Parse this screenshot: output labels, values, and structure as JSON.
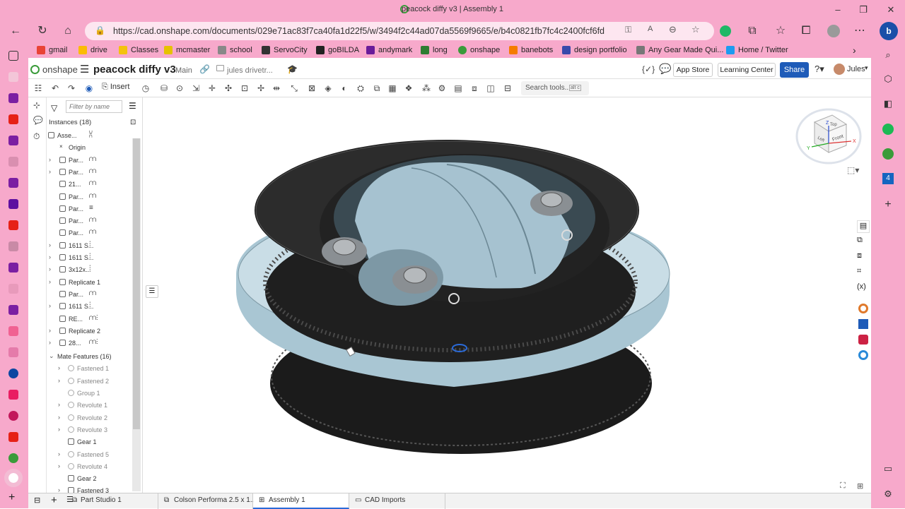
{
  "window": {
    "title": "peacock diffy v3 | Assembly 1"
  },
  "browser": {
    "url": "https://cad.onshape.com/documents/029e71ac83f7ca40fa1d22f5/w/3494f2c44ad07da5569f9665/e/b4c0821fb7fc4c2400fcf6fd"
  },
  "bookmarks": [
    "gmail",
    "drive",
    "Classes",
    "mcmaster",
    "school",
    "ServoCity",
    "goBILDA",
    "andymark",
    "long",
    "onshape",
    "banebots",
    "design portfolio",
    "Any Gear Made Qui...",
    "Home / Twitter"
  ],
  "colors": {
    "pink": "#f7a9cb",
    "share": "#1e5bb8",
    "accent": "#2a6ad8"
  },
  "onshape": {
    "brand": "onshape",
    "doc_title": "peacock diffy v3",
    "branch": "Main",
    "folder": "jules drivetr...",
    "app_store": "App Store",
    "learning_center": "Learning Center",
    "share": "Share",
    "user": "Jules"
  },
  "toolbar": {
    "insert": "Insert",
    "search": "Search tools...",
    "shortcut": "alt c"
  },
  "tree": {
    "filter_placeholder": "Filter by name",
    "instances_header": "Instances (18)",
    "rows": [
      {
        "label": "Asse...",
        "indent": 0,
        "chev": false
      },
      {
        "label": "Origin",
        "indent": 1,
        "chev": false
      },
      {
        "label": "Par...",
        "indent": 1,
        "chev": true
      },
      {
        "label": "Par...",
        "indent": 1,
        "chev": true
      },
      {
        "label": "21...",
        "indent": 1,
        "chev": false
      },
      {
        "label": "Par...",
        "indent": 1,
        "chev": false
      },
      {
        "label": "Par...",
        "indent": 1,
        "chev": false
      },
      {
        "label": "Par...",
        "indent": 1,
        "chev": false
      },
      {
        "label": "Par...",
        "indent": 1,
        "chev": false
      },
      {
        "label": "1611 S...",
        "indent": 1,
        "chev": true
      },
      {
        "label": "1611 S...",
        "indent": 1,
        "chev": true
      },
      {
        "label": "3x12x...",
        "indent": 1,
        "chev": true
      },
      {
        "label": "Replicate 1",
        "indent": 1,
        "chev": true
      },
      {
        "label": "Par...",
        "indent": 1,
        "chev": false
      },
      {
        "label": "1611 S...",
        "indent": 1,
        "chev": true
      },
      {
        "label": "RE...",
        "indent": 1,
        "chev": false
      },
      {
        "label": "Replicate 2",
        "indent": 1,
        "chev": true
      },
      {
        "label": "28...",
        "indent": 1,
        "chev": true
      }
    ],
    "mate_header": "Mate Features (16)",
    "mates": [
      {
        "label": "Fastened 1",
        "chev": true,
        "dim": true
      },
      {
        "label": "Fastened 2",
        "chev": true,
        "dim": true
      },
      {
        "label": "Group 1",
        "chev": false,
        "dim": true
      },
      {
        "label": "Revolute 1",
        "chev": true,
        "dim": true
      },
      {
        "label": "Revolute 2",
        "chev": true,
        "dim": true
      },
      {
        "label": "Revolute 3",
        "chev": true,
        "dim": true
      },
      {
        "label": "Gear 1",
        "chev": false,
        "dim": false
      },
      {
        "label": "Fastened 5",
        "chev": true,
        "dim": true
      },
      {
        "label": "Revolute 4",
        "chev": true,
        "dim": true
      },
      {
        "label": "Gear 2",
        "chev": false,
        "dim": false
      },
      {
        "label": "Fastened 3",
        "chev": true,
        "dim": false
      }
    ]
  },
  "bottom_tabs": [
    {
      "label": "Part Studio 1"
    },
    {
      "label": "Colson Performa 2.5 x 1..."
    },
    {
      "label": "Assembly 1"
    },
    {
      "label": "CAD Imports"
    }
  ],
  "view_cube": {
    "top": "Top",
    "front": "Front",
    "left": "Left",
    "x": "X",
    "y": "Y",
    "z": "Z"
  }
}
